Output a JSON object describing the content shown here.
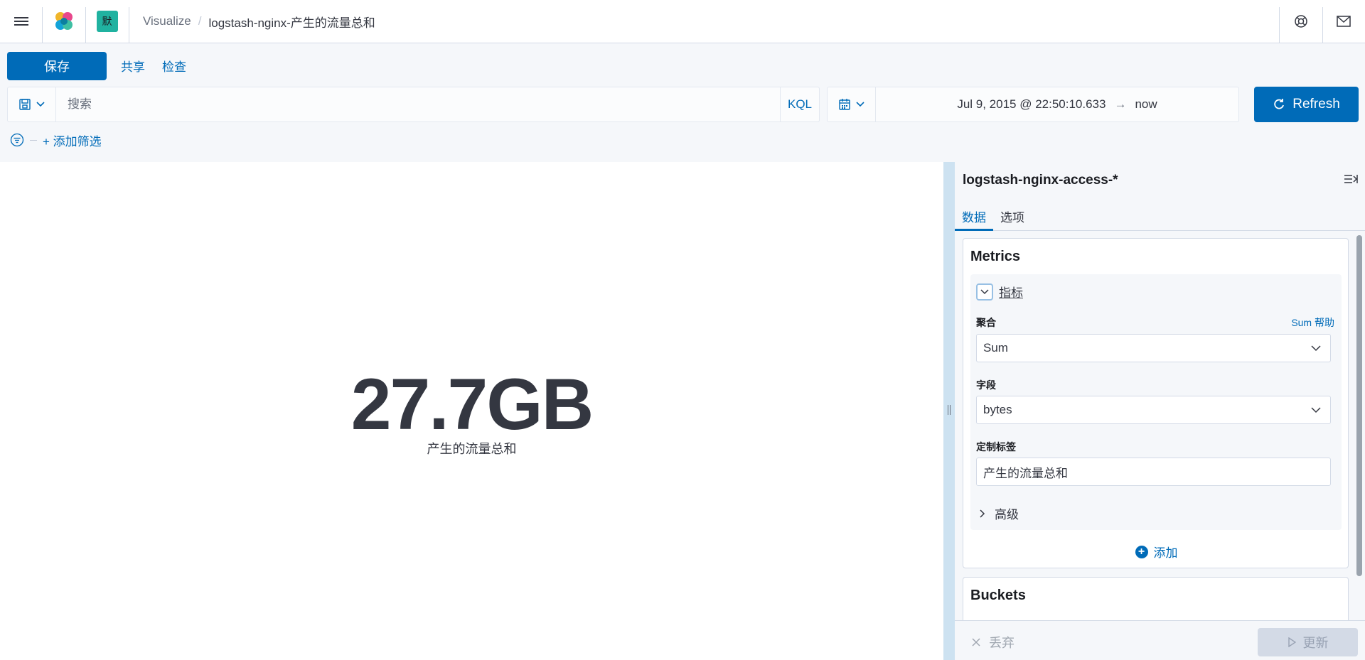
{
  "header": {
    "space_initial": "默",
    "breadcrumbs": {
      "parent": "Visualize",
      "separator": "/",
      "current": "logstash-nginx-产生的流量总和"
    },
    "icons": [
      "menu-icon",
      "elastic-logo",
      "help-icon",
      "mail-icon"
    ]
  },
  "toolbar": {
    "save_label": "保存",
    "share_label": "共享",
    "inspect_label": "检查"
  },
  "query": {
    "placeholder": "搜索",
    "language": "KQL"
  },
  "date": {
    "start": "Jul 9, 2015 @ 22:50:10.633",
    "arrow": "→",
    "end": "now"
  },
  "refresh_label": "Refresh",
  "filters": {
    "add_label": "+ 添加筛选"
  },
  "visualization": {
    "value": "27.7GB",
    "label": "产生的流量总和"
  },
  "sidebar": {
    "index_pattern": "logstash-nginx-access-*",
    "tabs": [
      {
        "label": "数据",
        "active": true
      },
      {
        "label": "选项",
        "active": false
      }
    ],
    "metrics_title": "Metrics",
    "agg": {
      "title": "指标",
      "aggregation_label": "聚合",
      "aggregation_help": "Sum 帮助",
      "aggregation_value": "Sum",
      "field_label": "字段",
      "field_value": "bytes",
      "custom_label_label": "定制标签",
      "custom_label_value": "产生的流量总和",
      "advanced_label": "高级"
    },
    "add_label": "添加",
    "buckets_title": "Buckets",
    "discard_label": "丢弃",
    "update_label": "更新"
  },
  "colors": {
    "primary": "#006bb8",
    "space_badge": "#20b2a0",
    "background": "#f5f7fa"
  }
}
